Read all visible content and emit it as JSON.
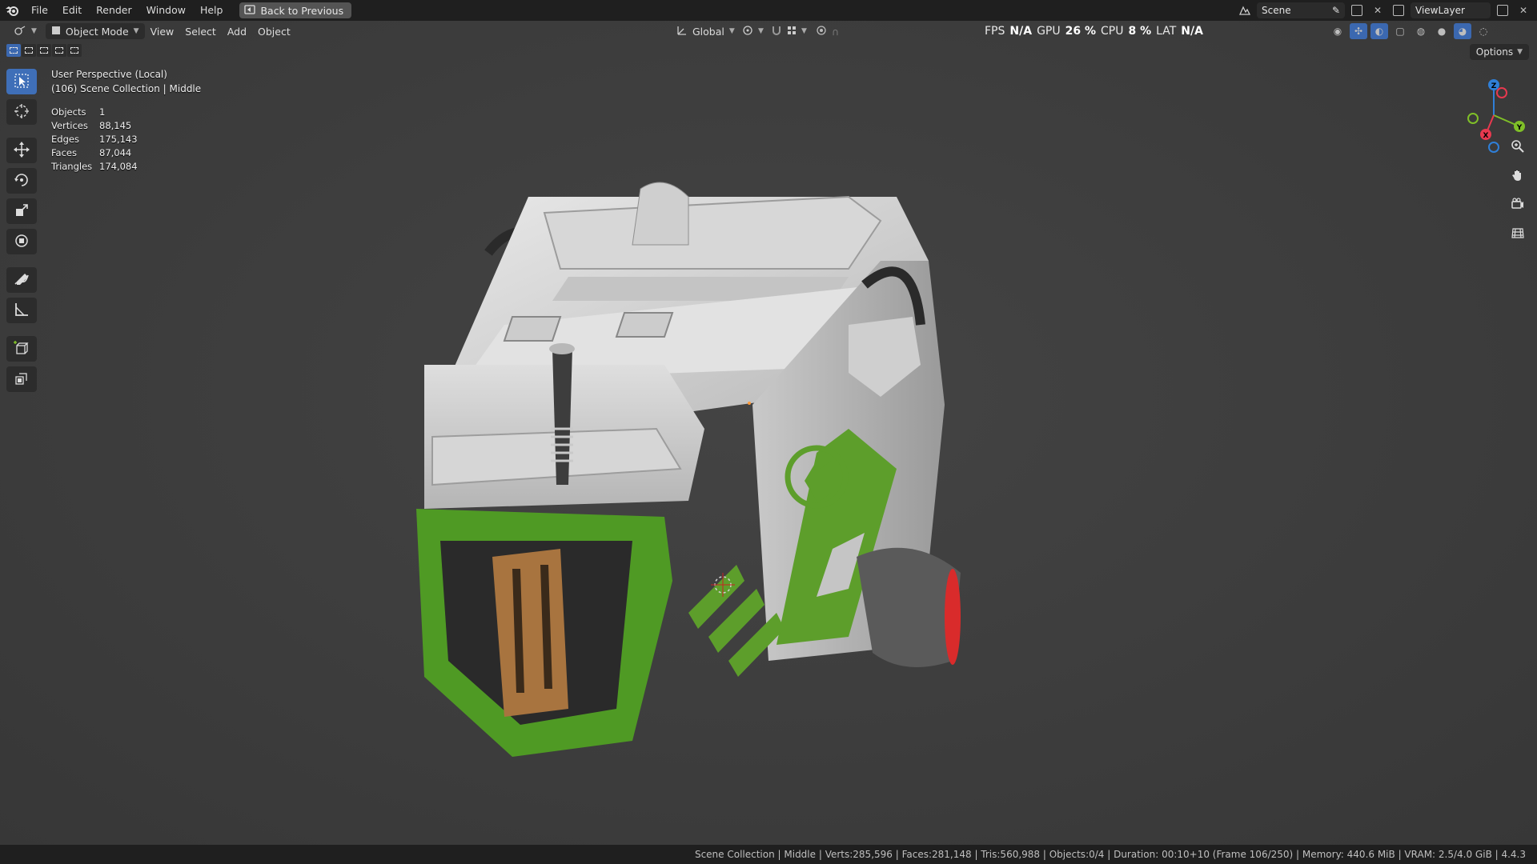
{
  "menu": {
    "items": [
      "File",
      "Edit",
      "Render",
      "Window",
      "Help"
    ],
    "back_label": "Back to Previous"
  },
  "topright": {
    "scene": "Scene",
    "view_layer": "ViewLayer"
  },
  "header": {
    "mode": "Object Mode",
    "view": "View",
    "select": "Select",
    "add": "Add",
    "object": "Object",
    "orientation": "Global",
    "options": "Options"
  },
  "perf": {
    "fps_label": "FPS",
    "fps_value": "N/A",
    "gpu_label": "GPU",
    "gpu_value": "26 %",
    "cpu_label": "CPU",
    "cpu_value": "8 %",
    "lat_label": "LAT",
    "lat_value": "N/A"
  },
  "overlay": {
    "perspective": "User Perspective (Local)",
    "collection": "(106) Scene Collection | Middle"
  },
  "stats": [
    {
      "k": "Objects",
      "v": "1"
    },
    {
      "k": "Vertices",
      "v": "88,145"
    },
    {
      "k": "Edges",
      "v": "175,143"
    },
    {
      "k": "Faces",
      "v": "87,044"
    },
    {
      "k": "Triangles",
      "v": "174,084"
    }
  ],
  "gizmo": {
    "z": "Z",
    "y": "Y",
    "x": "X",
    "colors": {
      "x": "#e8394f",
      "y": "#7fbf28",
      "z": "#2f7fd8"
    }
  },
  "statusbar": {
    "text": "Scene Collection | Middle | Verts:285,596 | Faces:281,148 | Tris:560,988 | Objects:0/4 | Duration: 00:10+10 (Frame 106/250) | Memory: 440.6 MiB | VRAM: 2.5/4.0 GiB | 4.4.3"
  },
  "icons": [
    "blender-logo-icon",
    "select-box-icon",
    "cursor-icon",
    "move-icon",
    "rotate-icon",
    "scale-icon",
    "transform-icon",
    "annotate-icon",
    "measure-icon",
    "add-cube-icon",
    "extrude-icon",
    "zoom-icon",
    "hand-icon",
    "camera-icon",
    "grid-icon"
  ]
}
